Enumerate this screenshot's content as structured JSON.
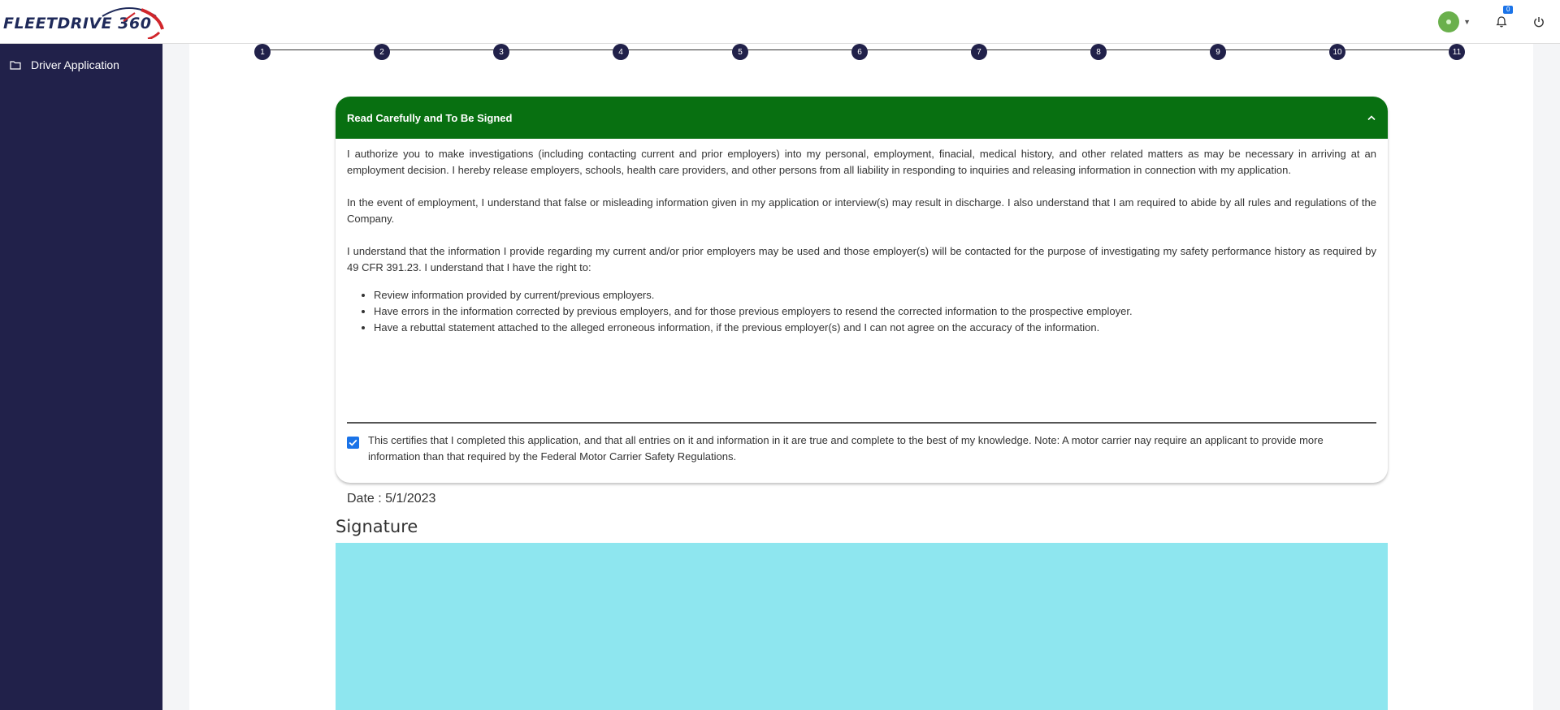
{
  "header": {
    "logo_text": "FLEETDRIVE 360",
    "notifications_count": "0"
  },
  "sidebar": {
    "items": [
      {
        "label": "Driver Application"
      }
    ]
  },
  "stepper": {
    "steps": [
      "1",
      "2",
      "3",
      "4",
      "5",
      "6",
      "7",
      "8",
      "9",
      "10",
      "11"
    ]
  },
  "card": {
    "title": "Read Carefully and To Be Signed",
    "paragraphs": [
      "I authorize you to make investigations (including contacting current and prior employers) into my personal, employment, finacial, medical history, and other related matters as may be necessary in arriving at an employment decision. I hereby release employers, schools, health care providers, and other persons from all liability in responding to inquiries and releasing information in connection with my application.",
      "In the event of employment, I understand that false or misleading information given in my application or interview(s) may result in discharge. I also understand that I am required to abide by all rules and regulations of the Company.",
      "I understand that the information I provide regarding my current and/or prior employers may be used and those employer(s) will be contacted for the purpose of investigating my safety performance history as required by 49 CFR 391.23. I understand that I have the right to:"
    ],
    "rights": [
      "Review information provided by current/previous employers.",
      "Have errors in the information corrected by previous employers, and for those previous employers to resend the corrected information to the prospective employer.",
      "Have a rebuttal statement attached to the alleged erroneous information, if the previous employer(s) and I can not agree on the accuracy of the information."
    ],
    "certification": "This certifies that I completed this application, and that all entries on it and information in it are true and complete to the best of my knowledge. Note: A motor carrier nay require an applicant to provide more information than that required by the Federal Motor Carrier Safety Regulations.",
    "certification_checked": true,
    "date_label": "Date : ",
    "date_value": "5/1/2023"
  },
  "signature": {
    "title": "Signature"
  },
  "colors": {
    "header_green": "#087011",
    "sidebar_navy": "#21214a",
    "signature_pad": "#8ee6ef",
    "checkbox_blue": "#1a73e8"
  }
}
